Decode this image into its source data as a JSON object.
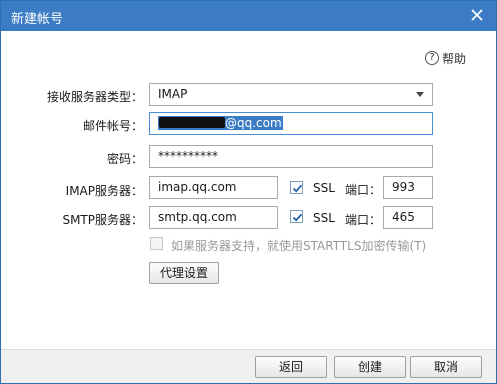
{
  "window": {
    "title": "新建帐号",
    "close_icon": "close-icon"
  },
  "help": {
    "label": "帮助",
    "icon": "help-circle-icon"
  },
  "form": {
    "receive_type": {
      "label": "接收服务器类型：",
      "value": "IMAP"
    },
    "account": {
      "label": "邮件帐号：",
      "value_visible_suffix": "@qq.com",
      "redacted": true
    },
    "password": {
      "label": "密码：",
      "value": "**********"
    },
    "imap": {
      "label": "IMAP服务器：",
      "value": "imap.qq.com",
      "ssl_label": "SSL",
      "ssl_checked": true,
      "port_label": "端口：",
      "port": "993"
    },
    "smtp": {
      "label": "SMTP服务器：",
      "value": "smtp.qq.com",
      "ssl_label": "SSL",
      "ssl_checked": true,
      "port_label": "端口：",
      "port": "465"
    },
    "starttls": {
      "label": "如果服务器支持，就使用STARTTLS加密传输(T)",
      "checked": false,
      "disabled": true
    },
    "proxy_button": "代理设置"
  },
  "footer": {
    "back": "返回",
    "create": "创建",
    "cancel": "取消"
  },
  "colors": {
    "titlebar": "#3b7cc4",
    "check": "#1f5fa8",
    "focus_border": "#4a90d9"
  }
}
